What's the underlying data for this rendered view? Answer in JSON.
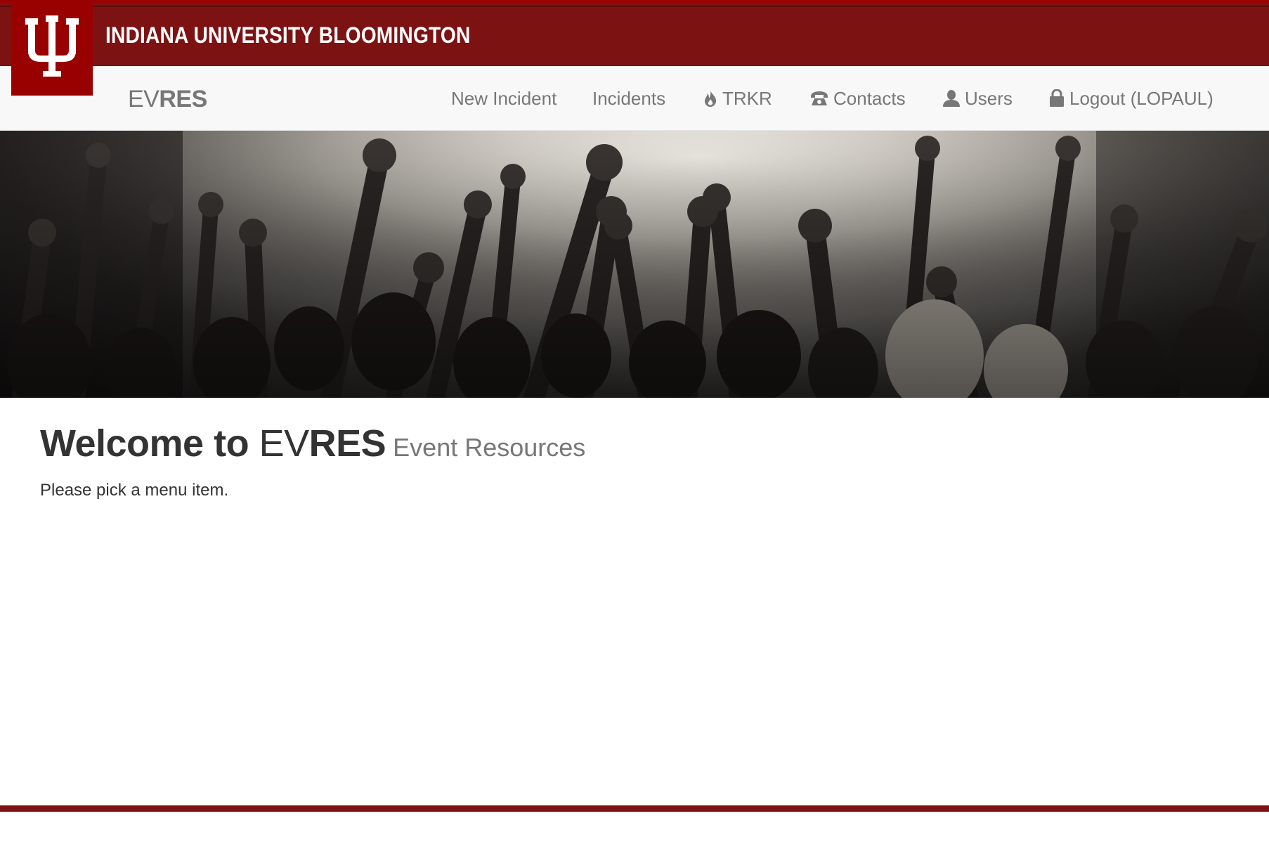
{
  "header": {
    "university": "INDIANA UNIVERSITY BLOOMINGTON",
    "logo_icon": "iu-trident-logo",
    "colors": {
      "crimson": "#7d1213",
      "logo_crimson": "#990000"
    }
  },
  "navbar": {
    "brand_light": "EV",
    "brand_bold": "RES",
    "items": [
      {
        "label": "New Incident",
        "icon": ""
      },
      {
        "label": "Incidents",
        "icon": ""
      },
      {
        "label": "TRKR",
        "icon": "fire-icon"
      },
      {
        "label": "Contacts",
        "icon": "phone-icon"
      },
      {
        "label": "Users",
        "icon": "user-icon"
      },
      {
        "label": "Logout (LOPAUL)",
        "icon": "lock-icon"
      }
    ]
  },
  "hero": {
    "image": "concert-crowd-raised-hands-photo"
  },
  "main": {
    "welcome_prefix": "Welcome to ",
    "welcome_ev": "EV",
    "welcome_res": "RES",
    "welcome_subtitle": "Event Resources",
    "instruction": "Please pick a menu item."
  }
}
